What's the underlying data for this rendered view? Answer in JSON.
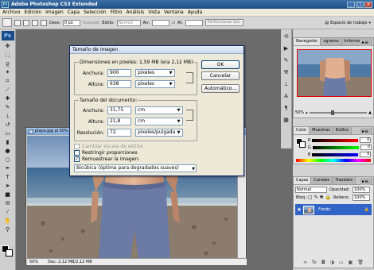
{
  "app": {
    "title": "Adobe Photoshop CS3 Extended",
    "icon": "Ps"
  },
  "menu": [
    "Archivo",
    "Edición",
    "Imagen",
    "Capa",
    "Selección",
    "Filtro",
    "Análisis",
    "Vista",
    "Ventana",
    "Ayuda"
  ],
  "options": {
    "desv_label": "Desv:",
    "desv_value": "0 px",
    "suavizar": "Suavizar",
    "estilo_label": "Estilo:",
    "estilo_value": "Normal",
    "an_label": "An:",
    "al_label": "Al:",
    "refine": "Perfeccionar bor.",
    "workspace": "Espacio de trabajo"
  },
  "document": {
    "title": "playa.jpg al 50% (",
    "zoom": "50%",
    "doc_info": "Doc: 2,12 MB/2,12 MB"
  },
  "dialog": {
    "title": "Tamaño de imagen",
    "pixel_dims_label": "Dimensiones en píxeles: 1,59 MB (era 2,12 MB)",
    "px_width_label": "Anchura:",
    "px_width_value": "900",
    "px_width_unit": "píxeles",
    "px_height_label": "Altura:",
    "px_height_value": "638",
    "px_height_unit": "píxeles",
    "doc_size_label": "Tamaño del documento:",
    "doc_width_label": "Anchura:",
    "doc_width_value": "31,75",
    "doc_width_unit": "cm",
    "doc_height_label": "Altura:",
    "doc_height_value": "21,8",
    "doc_height_unit": "cm",
    "resolution_label": "Resolución:",
    "resolution_value": "72",
    "resolution_unit": "píxeles/pulgada",
    "chk_scale_styles": "Cambiar escala de estilos",
    "chk_constrain": "Restringir proporciones",
    "chk_resample": "Remuestrear la imagen:",
    "resample_method": "Bicúbica (óptima para degradados suaves)",
    "ok": "OK",
    "cancel": "Cancelar",
    "auto": "Automático..."
  },
  "navigator": {
    "tabs": [
      "Navegador",
      "ograma",
      "Información"
    ],
    "zoom": "50%"
  },
  "color_panel": {
    "tabs": [
      "Color",
      "Muestras",
      "Estilos"
    ],
    "channels": [
      {
        "label": "R",
        "value": "0"
      },
      {
        "label": "G",
        "value": "0"
      },
      {
        "label": "B",
        "value": "0"
      }
    ]
  },
  "layers_panel": {
    "tabs": [
      "Capas",
      "Canales",
      "Trazados"
    ],
    "blend_mode": "Normal",
    "opacity_label": "Opacidad:",
    "opacity_value": "100%",
    "lock_label": "Bloq.:",
    "fill_label": "Relleno:",
    "fill_value": "100%",
    "layer_name": "Fondo"
  }
}
